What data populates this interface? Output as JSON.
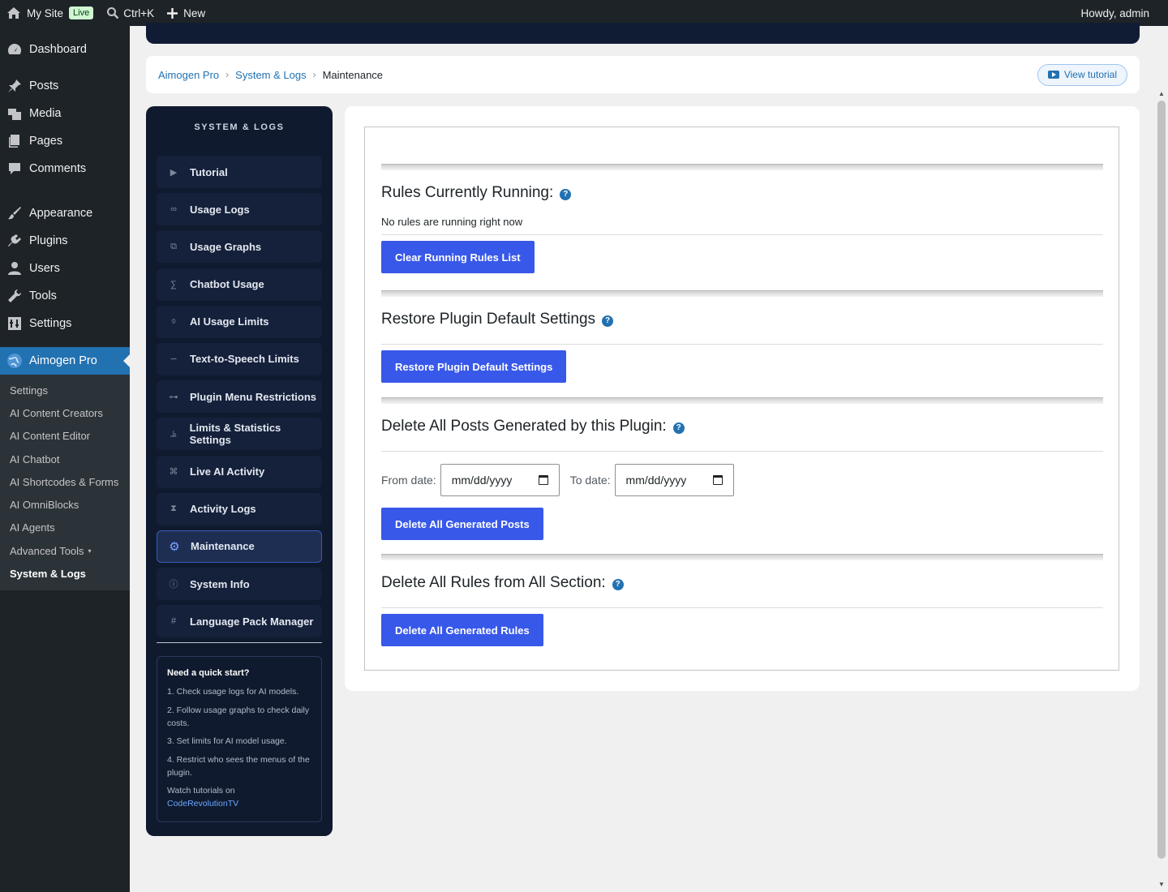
{
  "adminbar": {
    "site_name": "My Site",
    "live_badge": "Live",
    "search_shortcut": "Ctrl+K",
    "new_label": "New",
    "greeting": "Howdy, admin"
  },
  "admin_menu": {
    "items": [
      {
        "label": "Dashboard",
        "icon": "dashboard-icon"
      },
      {
        "label": "Posts",
        "icon": "pin-icon"
      },
      {
        "label": "Media",
        "icon": "media-icon"
      },
      {
        "label": "Pages",
        "icon": "pages-icon"
      },
      {
        "label": "Comments",
        "icon": "comment-icon"
      },
      {
        "label": "Appearance",
        "icon": "brush-icon"
      },
      {
        "label": "Plugins",
        "icon": "plugin-icon"
      },
      {
        "label": "Users",
        "icon": "user-icon"
      },
      {
        "label": "Tools",
        "icon": "wrench-icon"
      },
      {
        "label": "Settings",
        "icon": "settings-icon"
      },
      {
        "label": "Aimogen Pro",
        "icon": "globe-icon"
      }
    ],
    "submenu": [
      {
        "label": "Settings"
      },
      {
        "label": "AI Content Creators"
      },
      {
        "label": "AI Content Editor"
      },
      {
        "label": "AI Chatbot"
      },
      {
        "label": "AI Shortcodes & Forms"
      },
      {
        "label": "AI OmniBlocks"
      },
      {
        "label": "AI Agents"
      },
      {
        "label": "Advanced Tools",
        "caret": "▾"
      },
      {
        "label": "System & Logs"
      }
    ]
  },
  "breadcrumb": {
    "items": [
      "Aimogen Pro",
      "System & Logs"
    ],
    "separator": "›",
    "current": "Maintenance",
    "tutorial_label": "View tutorial"
  },
  "plugin_nav": {
    "title": "SYSTEM & LOGS",
    "items": [
      {
        "label": "Tutorial",
        "glyph": "▶"
      },
      {
        "label": "Usage Logs",
        "glyph": "∞"
      },
      {
        "label": "Usage Graphs",
        "glyph": "⧉"
      },
      {
        "label": "Chatbot Usage",
        "glyph": "∑"
      },
      {
        "label": "AI Usage Limits",
        "glyph": "⌽"
      },
      {
        "label": "Text-to-Speech Limits",
        "glyph": "∽"
      },
      {
        "label": "Plugin Menu Restrictions",
        "glyph": "⊶"
      },
      {
        "label": "Limits & Statistics Settings",
        "glyph": "⫡"
      },
      {
        "label": "Live AI Activity",
        "glyph": "⌘"
      },
      {
        "label": "Activity Logs",
        "glyph": "⧗"
      },
      {
        "label": "Maintenance",
        "glyph": "⚙"
      },
      {
        "label": "System Info",
        "glyph": "ⓘ"
      },
      {
        "label": "Language Pack Manager",
        "glyph": "#"
      }
    ],
    "quickstart": {
      "title": "Need a quick start?",
      "steps": [
        "1. Check usage logs for AI models.",
        "2. Follow usage graphs to check daily costs.",
        "3. Set limits for AI model usage.",
        "4. Restrict who sees the menus of the plugin."
      ],
      "watch_text": "Watch tutorials on",
      "watch_link": "CodeRevolutionTV"
    }
  },
  "maintenance": {
    "running": {
      "title": "Rules Currently Running:",
      "status": "No rules are running right now",
      "button": "Clear Running Rules List"
    },
    "restore": {
      "title": "Restore Plugin Default Settings",
      "button": "Restore Plugin Default Settings"
    },
    "delete_posts": {
      "title": "Delete All Posts Generated by this Plugin:",
      "from_label": "From date:",
      "from_value": "mm/dd/yyyy",
      "to_label": "To date:",
      "to_value": "mm/dd/yyyy",
      "button": "Delete All Generated Posts"
    },
    "delete_rules": {
      "title": "Delete All Rules from All Section:",
      "button": "Delete All Generated Rules"
    },
    "help_glyph": "?"
  },
  "colors": {
    "accent": "#3858e9",
    "admin_dark": "#1d2327",
    "wp_blue": "#2271b1",
    "plugin_nav_bg": "#101a2e"
  }
}
